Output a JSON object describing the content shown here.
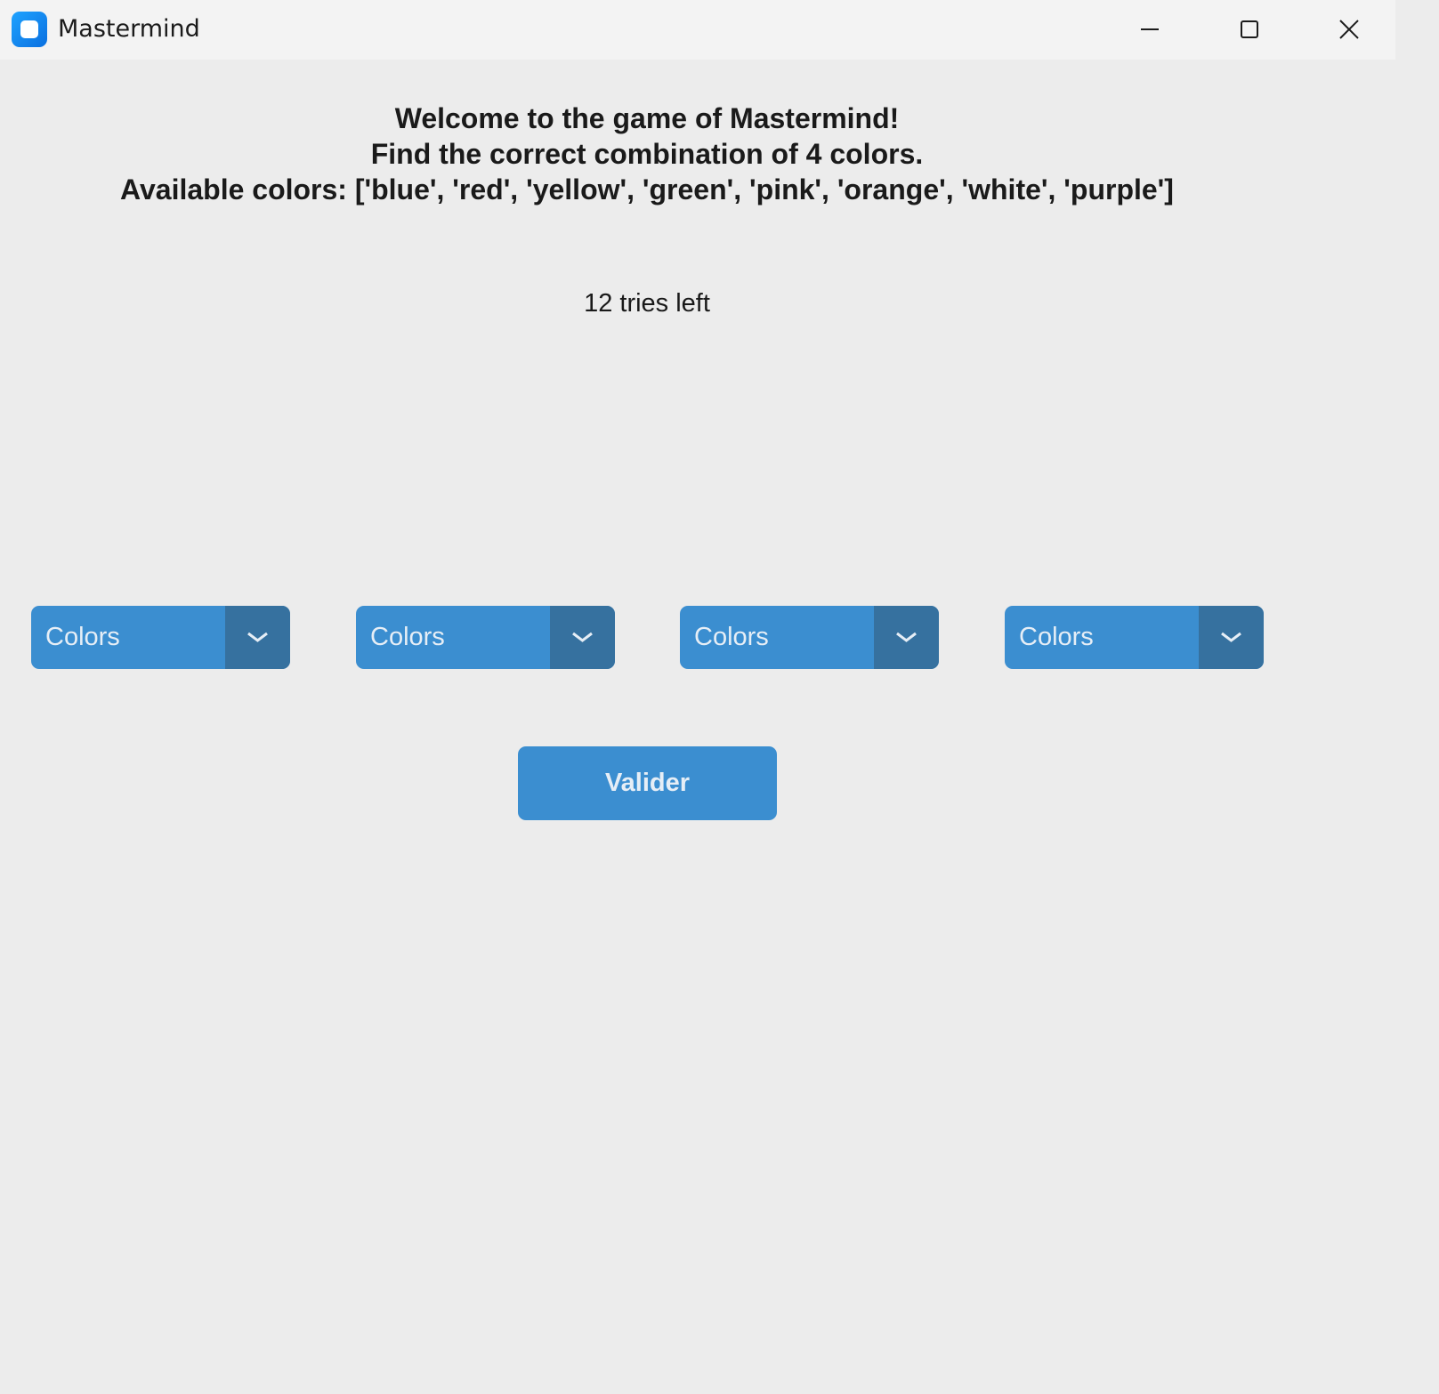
{
  "window": {
    "title": "Mastermind",
    "icon": "app-icon",
    "controls": [
      "minimize-icon",
      "maximize-icon",
      "close-icon"
    ]
  },
  "header": {
    "line1": "Welcome to the game of Mastermind!",
    "line2": "Find the correct combination of 4 colors.",
    "line3": "Available colors: ['blue', 'red', 'yellow', 'green', 'pink', 'orange', 'white', 'purple']"
  },
  "status": {
    "tries_left": "12 tries left"
  },
  "selectors": [
    {
      "value": "Colors"
    },
    {
      "value": "Colors"
    },
    {
      "value": "Colors"
    },
    {
      "value": "Colors"
    }
  ],
  "actions": {
    "validate_label": "Valider"
  },
  "theme": {
    "background": "#ececec",
    "titlebar": "#f3f3f3",
    "button": "#3b8ed0",
    "button_dark": "#36719f",
    "button_text": "#e6eef6"
  }
}
